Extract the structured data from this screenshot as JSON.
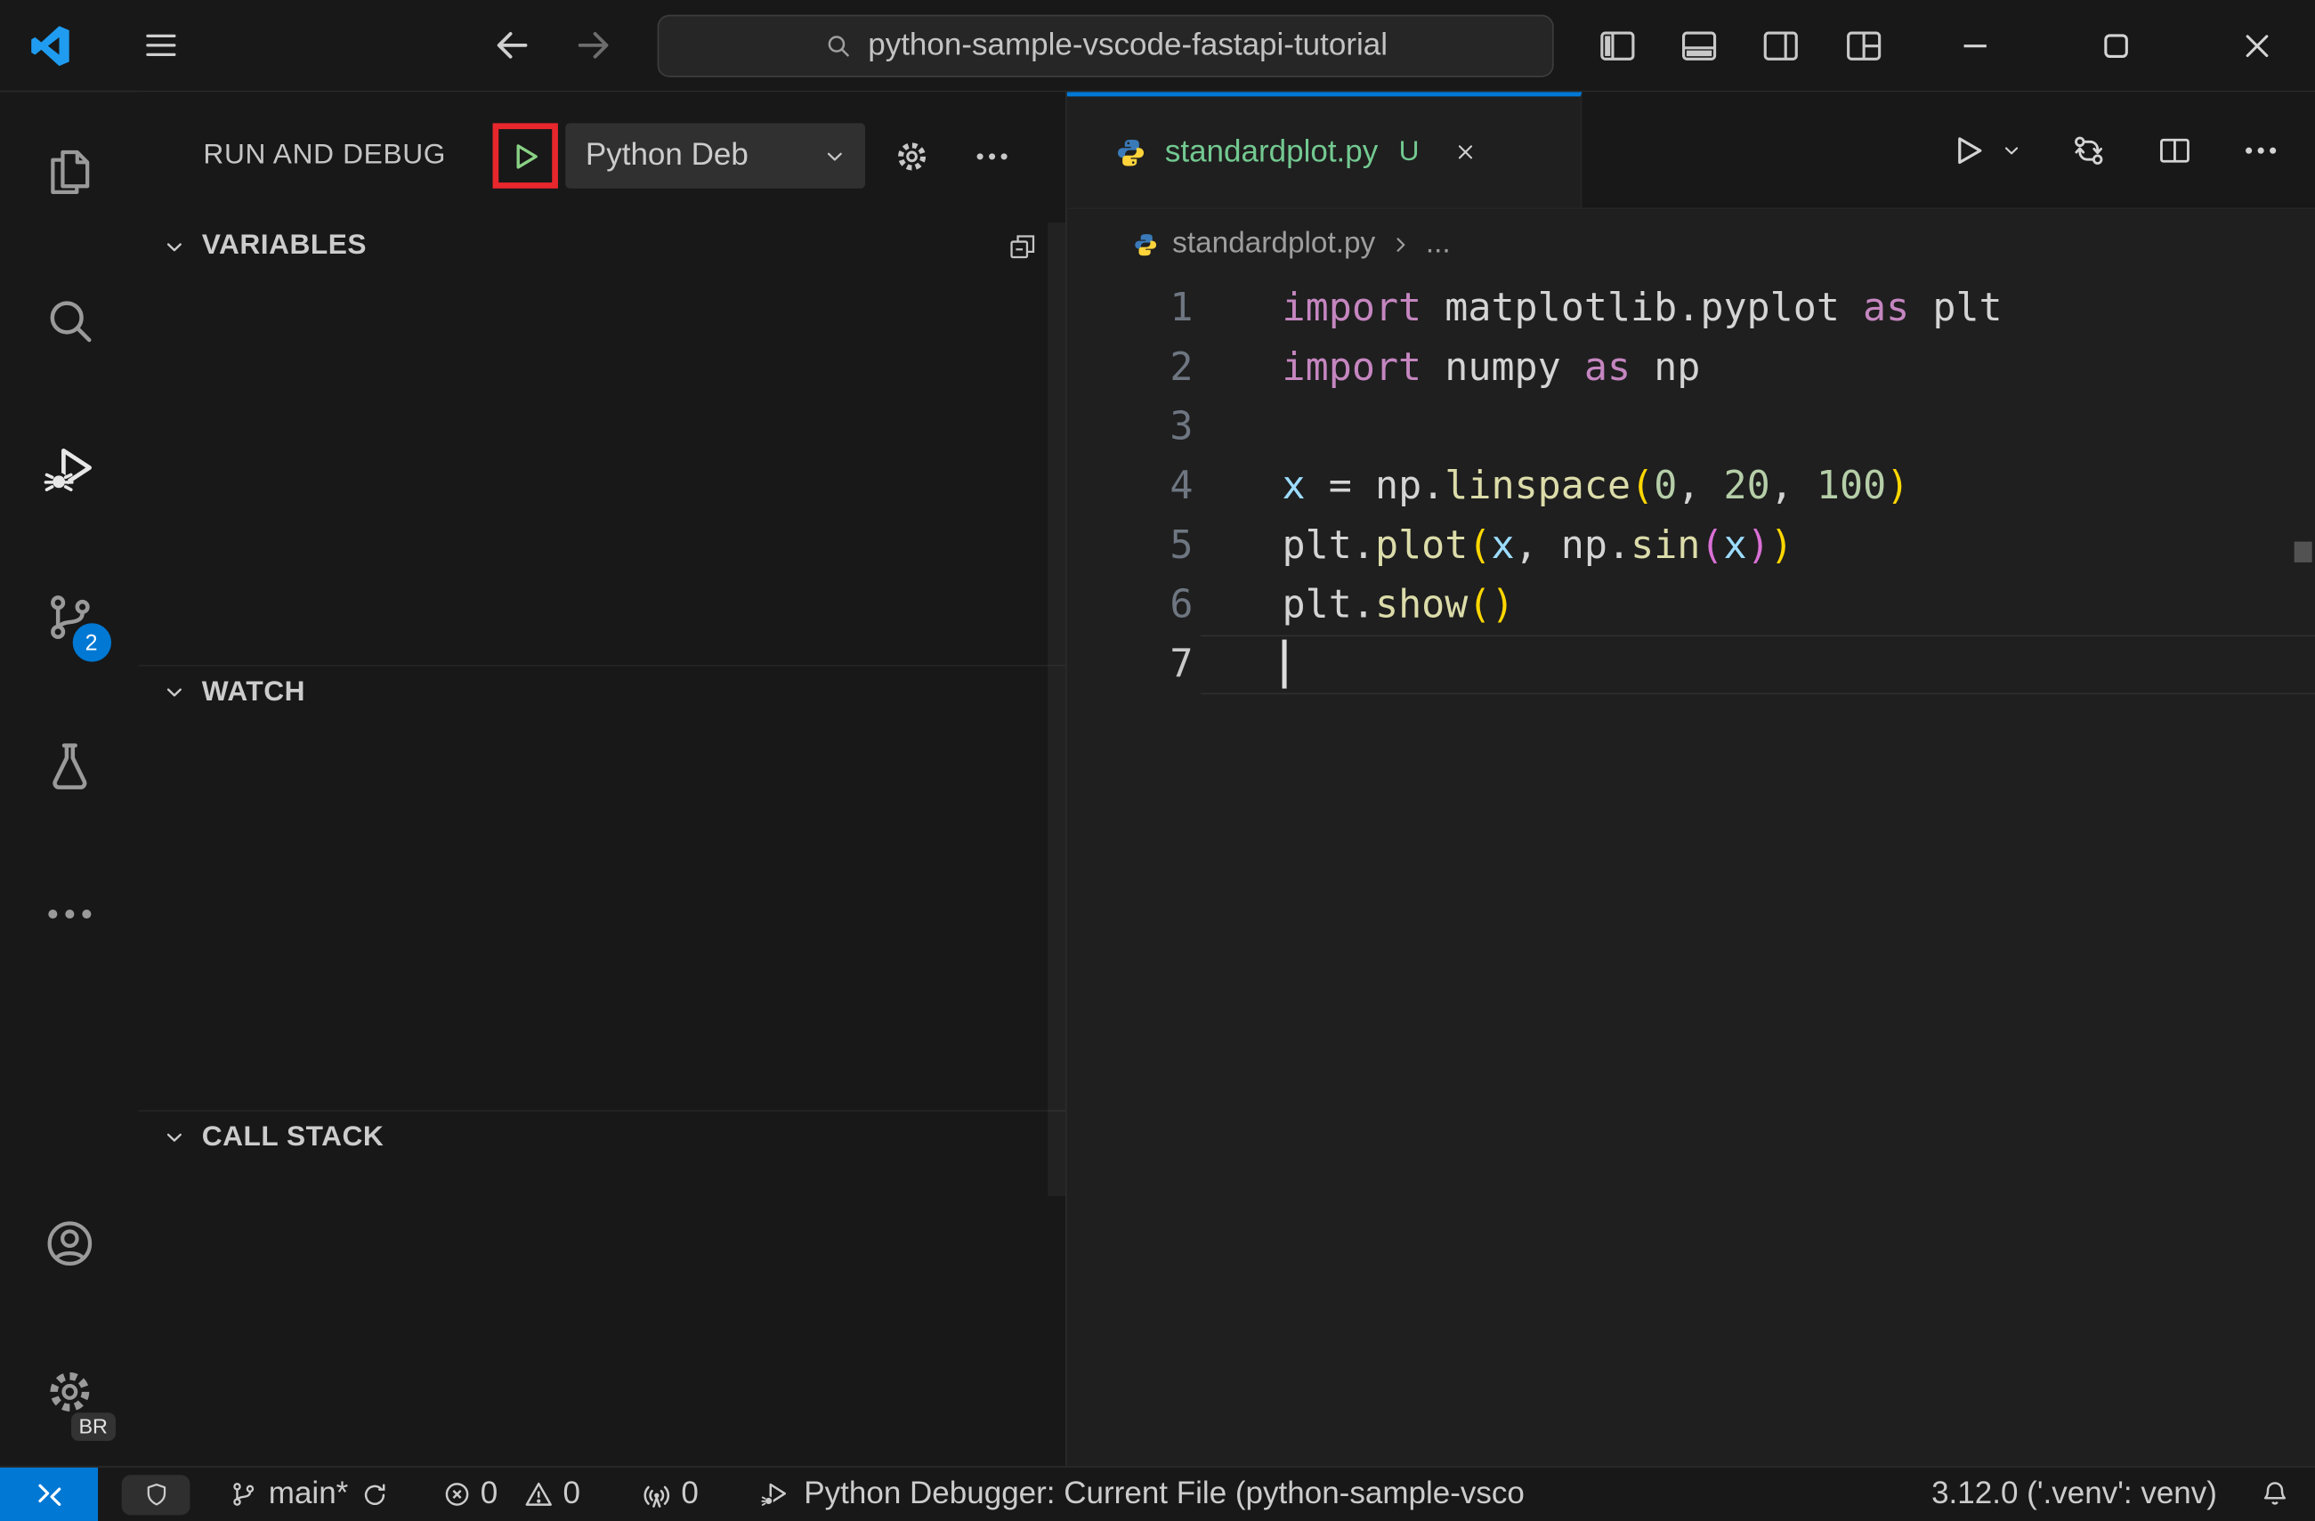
{
  "titlebar": {
    "search_text": "python-sample-vscode-fastapi-tutorial"
  },
  "activity_bar": {
    "scm_badge": "2",
    "profile_badge": "BR"
  },
  "sidebar": {
    "title": "RUN AND DEBUG",
    "debug_config": "Python Deb",
    "sections": [
      {
        "label": "VARIABLES"
      },
      {
        "label": "WATCH"
      },
      {
        "label": "CALL STACK"
      }
    ]
  },
  "editor": {
    "tab": {
      "label": "standardplot.py",
      "modified_badge": "U"
    },
    "breadcrumb": {
      "file": "standardplot.py",
      "more": "..."
    },
    "code": {
      "active_line": 7,
      "lines": [
        {
          "num": 1,
          "tokens": [
            [
              "kw",
              "import"
            ],
            [
              "pl",
              " "
            ],
            [
              "id",
              "matplotlib.pyplot"
            ],
            [
              "pl",
              " "
            ],
            [
              "kw",
              "as"
            ],
            [
              "pl",
              " "
            ],
            [
              "id",
              "plt"
            ]
          ]
        },
        {
          "num": 2,
          "tokens": [
            [
              "kw",
              "import"
            ],
            [
              "pl",
              " "
            ],
            [
              "id",
              "numpy"
            ],
            [
              "pl",
              " "
            ],
            [
              "kw",
              "as"
            ],
            [
              "pl",
              " "
            ],
            [
              "id",
              "np"
            ]
          ]
        },
        {
          "num": 3,
          "tokens": []
        },
        {
          "num": 4,
          "tokens": [
            [
              "var",
              "x"
            ],
            [
              "pl",
              " = "
            ],
            [
              "id",
              "np"
            ],
            [
              "pl",
              "."
            ],
            [
              "fn",
              "linspace"
            ],
            [
              "b1",
              "("
            ],
            [
              "num",
              "0"
            ],
            [
              "pl",
              ", "
            ],
            [
              "num",
              "20"
            ],
            [
              "pl",
              ", "
            ],
            [
              "num",
              "100"
            ],
            [
              "b1",
              ")"
            ]
          ]
        },
        {
          "num": 5,
          "tokens": [
            [
              "id",
              "plt"
            ],
            [
              "pl",
              "."
            ],
            [
              "fn",
              "plot"
            ],
            [
              "b1",
              "("
            ],
            [
              "var",
              "x"
            ],
            [
              "pl",
              ", "
            ],
            [
              "id",
              "np"
            ],
            [
              "pl",
              "."
            ],
            [
              "fn",
              "sin"
            ],
            [
              "b2",
              "("
            ],
            [
              "var",
              "x"
            ],
            [
              "b2",
              ")"
            ],
            [
              "b1",
              ")"
            ]
          ]
        },
        {
          "num": 6,
          "tokens": [
            [
              "id",
              "plt"
            ],
            [
              "pl",
              "."
            ],
            [
              "fn",
              "show"
            ],
            [
              "b1",
              "("
            ],
            [
              "b1",
              ")"
            ]
          ]
        },
        {
          "num": 7,
          "tokens": [],
          "cursor": true
        }
      ]
    }
  },
  "status_bar": {
    "branch": "main*",
    "errors": "0",
    "warnings": "0",
    "ports": "0",
    "debug_status": "Python Debugger: Current File (python-sample-vsco",
    "python_version": "3.12.0 ('.venv': venv)"
  },
  "icons": {
    "titlebar": [
      "vscode-logo",
      "hamburger-menu",
      "arrow-left",
      "arrow-right",
      "magnifier",
      "layout-sidebar-left",
      "layout-panel-bottom",
      "layout-sidebar-right",
      "customize-layout",
      "minimize",
      "maximize",
      "close"
    ],
    "activity_bar": [
      "explorer-files",
      "search",
      "run-and-debug",
      "source-control-branch",
      "testing-beaker",
      "ellipsis",
      "account",
      "settings-gear"
    ],
    "sidebar": [
      "debug-start-play",
      "chevron-down",
      "gear",
      "ellipsis",
      "collapse-all"
    ],
    "editor": [
      "python-logo",
      "close-x",
      "run-play",
      "chevron-down",
      "open-changes",
      "split-editor",
      "ellipsis",
      "chevron-right"
    ],
    "status_bar": [
      "remote",
      "shield",
      "git-branch",
      "sync",
      "error-circle",
      "warning-triangle",
      "radio-tower",
      "debug-play-bug",
      "bell"
    ]
  },
  "colors": {
    "accent": "#0078d4",
    "untracked": "#73c991",
    "annotation_red": "#e8272d",
    "debug_green": "#89d185",
    "tok_keyword": "#c586c0",
    "tok_variable": "#9cdcfe",
    "tok_function": "#dcdcaa",
    "tok_number": "#b5cea8",
    "tok_plain": "#d4d4d4",
    "tok_bracket1": "#ffd700",
    "tok_bracket2": "#da70d6"
  }
}
